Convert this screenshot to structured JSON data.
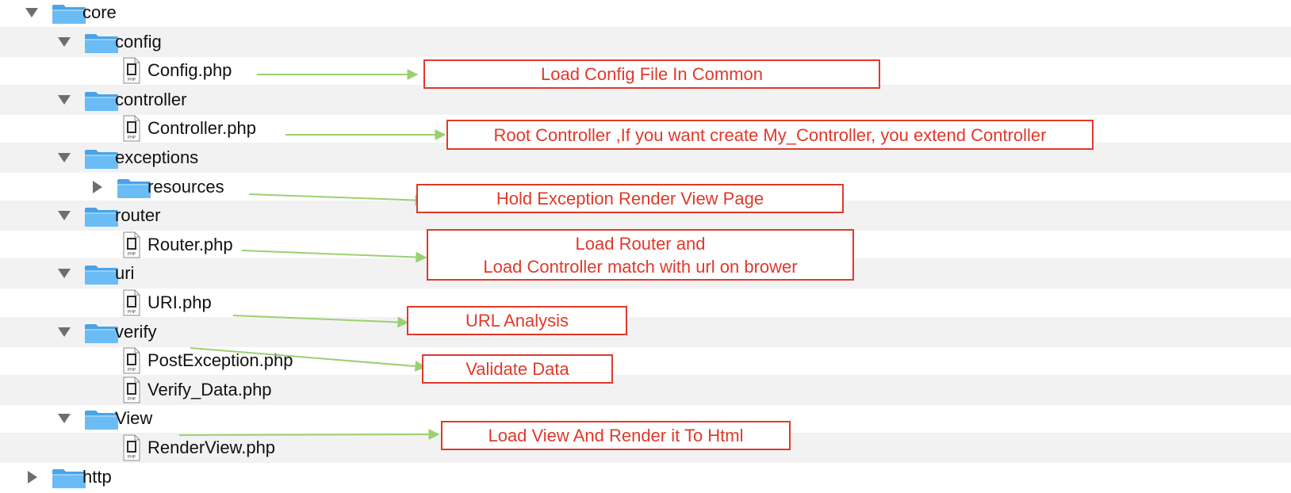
{
  "colors": {
    "annotation_red": "#e0392b",
    "arrow_green": "#9bd071",
    "folder_blue": "#6bbcf5",
    "row_stripe": "#f2f2f2",
    "disclosure_gray": "#6e6e6e"
  },
  "tree": {
    "rows": [
      {
        "name": "core",
        "type": "folder",
        "level": 0,
        "expanded": true,
        "icon": "folder-icon"
      },
      {
        "name": "config",
        "type": "folder",
        "level": 1,
        "expanded": true,
        "icon": "folder-icon"
      },
      {
        "name": "Config.php",
        "type": "file",
        "level": 2,
        "icon": "php-file-icon"
      },
      {
        "name": "controller",
        "type": "folder",
        "level": 1,
        "expanded": true,
        "icon": "folder-icon"
      },
      {
        "name": "Controller.php",
        "type": "file",
        "level": 2,
        "icon": "php-file-icon"
      },
      {
        "name": "exceptions",
        "type": "folder",
        "level": 1,
        "expanded": true,
        "icon": "folder-icon"
      },
      {
        "name": "resources",
        "type": "folder",
        "level": 2,
        "expanded": false,
        "icon": "folder-icon"
      },
      {
        "name": "router",
        "type": "folder",
        "level": 1,
        "expanded": true,
        "icon": "folder-icon"
      },
      {
        "name": "Router.php",
        "type": "file",
        "level": 2,
        "icon": "php-file-icon"
      },
      {
        "name": "uri",
        "type": "folder",
        "level": 1,
        "expanded": true,
        "icon": "folder-icon"
      },
      {
        "name": "URI.php",
        "type": "file",
        "level": 2,
        "icon": "php-file-icon"
      },
      {
        "name": "verify",
        "type": "folder",
        "level": 1,
        "expanded": true,
        "icon": "folder-icon"
      },
      {
        "name": "PostException.php",
        "type": "file",
        "level": 2,
        "icon": "php-file-icon"
      },
      {
        "name": "Verify_Data.php",
        "type": "file",
        "level": 2,
        "icon": "php-file-icon"
      },
      {
        "name": "View",
        "type": "folder",
        "level": 1,
        "expanded": true,
        "icon": "folder-icon"
      },
      {
        "name": "RenderView.php",
        "type": "file",
        "level": 2,
        "icon": "php-file-icon"
      },
      {
        "name": "http",
        "type": "folder",
        "level": 0,
        "expanded": false,
        "icon": "folder-icon"
      }
    ]
  },
  "annotations": [
    {
      "id": "config",
      "lines": [
        "Load Config File In Common"
      ]
    },
    {
      "id": "controller",
      "lines": [
        "Root Controller ,If you want create My_Controller, you extend Controller"
      ]
    },
    {
      "id": "resources",
      "lines": [
        "Hold Exception Render View Page"
      ]
    },
    {
      "id": "router",
      "lines": [
        "Load Router  and",
        "Load Controller match with url on brower"
      ]
    },
    {
      "id": "uri",
      "lines": [
        "URL Analysis"
      ]
    },
    {
      "id": "verify",
      "lines": [
        "Validate Data"
      ]
    },
    {
      "id": "view",
      "lines": [
        "Load View And Render it To Html"
      ]
    }
  ]
}
